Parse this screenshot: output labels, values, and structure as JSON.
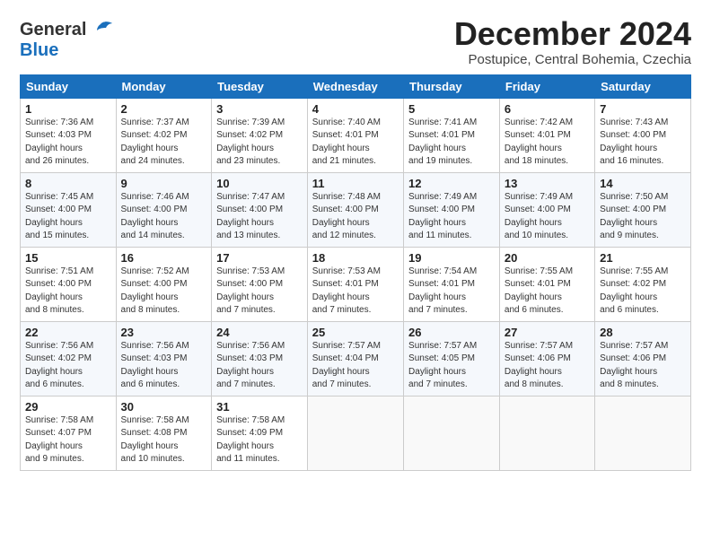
{
  "header": {
    "logo_general": "General",
    "logo_blue": "Blue",
    "month_title": "December 2024",
    "location": "Postupice, Central Bohemia, Czechia"
  },
  "weekdays": [
    "Sunday",
    "Monday",
    "Tuesday",
    "Wednesday",
    "Thursday",
    "Friday",
    "Saturday"
  ],
  "weeks": [
    [
      {
        "day": "1",
        "sunrise": "7:36 AM",
        "sunset": "4:03 PM",
        "daylight": "8 hours and 26 minutes."
      },
      {
        "day": "2",
        "sunrise": "7:37 AM",
        "sunset": "4:02 PM",
        "daylight": "8 hours and 24 minutes."
      },
      {
        "day": "3",
        "sunrise": "7:39 AM",
        "sunset": "4:02 PM",
        "daylight": "8 hours and 23 minutes."
      },
      {
        "day": "4",
        "sunrise": "7:40 AM",
        "sunset": "4:01 PM",
        "daylight": "8 hours and 21 minutes."
      },
      {
        "day": "5",
        "sunrise": "7:41 AM",
        "sunset": "4:01 PM",
        "daylight": "8 hours and 19 minutes."
      },
      {
        "day": "6",
        "sunrise": "7:42 AM",
        "sunset": "4:01 PM",
        "daylight": "8 hours and 18 minutes."
      },
      {
        "day": "7",
        "sunrise": "7:43 AM",
        "sunset": "4:00 PM",
        "daylight": "8 hours and 16 minutes."
      }
    ],
    [
      {
        "day": "8",
        "sunrise": "7:45 AM",
        "sunset": "4:00 PM",
        "daylight": "8 hours and 15 minutes."
      },
      {
        "day": "9",
        "sunrise": "7:46 AM",
        "sunset": "4:00 PM",
        "daylight": "8 hours and 14 minutes."
      },
      {
        "day": "10",
        "sunrise": "7:47 AM",
        "sunset": "4:00 PM",
        "daylight": "8 hours and 13 minutes."
      },
      {
        "day": "11",
        "sunrise": "7:48 AM",
        "sunset": "4:00 PM",
        "daylight": "8 hours and 12 minutes."
      },
      {
        "day": "12",
        "sunrise": "7:49 AM",
        "sunset": "4:00 PM",
        "daylight": "8 hours and 11 minutes."
      },
      {
        "day": "13",
        "sunrise": "7:49 AM",
        "sunset": "4:00 PM",
        "daylight": "8 hours and 10 minutes."
      },
      {
        "day": "14",
        "sunrise": "7:50 AM",
        "sunset": "4:00 PM",
        "daylight": "8 hours and 9 minutes."
      }
    ],
    [
      {
        "day": "15",
        "sunrise": "7:51 AM",
        "sunset": "4:00 PM",
        "daylight": "8 hours and 8 minutes."
      },
      {
        "day": "16",
        "sunrise": "7:52 AM",
        "sunset": "4:00 PM",
        "daylight": "8 hours and 8 minutes."
      },
      {
        "day": "17",
        "sunrise": "7:53 AM",
        "sunset": "4:00 PM",
        "daylight": "8 hours and 7 minutes."
      },
      {
        "day": "18",
        "sunrise": "7:53 AM",
        "sunset": "4:01 PM",
        "daylight": "8 hours and 7 minutes."
      },
      {
        "day": "19",
        "sunrise": "7:54 AM",
        "sunset": "4:01 PM",
        "daylight": "8 hours and 7 minutes."
      },
      {
        "day": "20",
        "sunrise": "7:55 AM",
        "sunset": "4:01 PM",
        "daylight": "8 hours and 6 minutes."
      },
      {
        "day": "21",
        "sunrise": "7:55 AM",
        "sunset": "4:02 PM",
        "daylight": "8 hours and 6 minutes."
      }
    ],
    [
      {
        "day": "22",
        "sunrise": "7:56 AM",
        "sunset": "4:02 PM",
        "daylight": "8 hours and 6 minutes."
      },
      {
        "day": "23",
        "sunrise": "7:56 AM",
        "sunset": "4:03 PM",
        "daylight": "8 hours and 6 minutes."
      },
      {
        "day": "24",
        "sunrise": "7:56 AM",
        "sunset": "4:03 PM",
        "daylight": "8 hours and 7 minutes."
      },
      {
        "day": "25",
        "sunrise": "7:57 AM",
        "sunset": "4:04 PM",
        "daylight": "8 hours and 7 minutes."
      },
      {
        "day": "26",
        "sunrise": "7:57 AM",
        "sunset": "4:05 PM",
        "daylight": "8 hours and 7 minutes."
      },
      {
        "day": "27",
        "sunrise": "7:57 AM",
        "sunset": "4:06 PM",
        "daylight": "8 hours and 8 minutes."
      },
      {
        "day": "28",
        "sunrise": "7:57 AM",
        "sunset": "4:06 PM",
        "daylight": "8 hours and 8 minutes."
      }
    ],
    [
      {
        "day": "29",
        "sunrise": "7:58 AM",
        "sunset": "4:07 PM",
        "daylight": "8 hours and 9 minutes."
      },
      {
        "day": "30",
        "sunrise": "7:58 AM",
        "sunset": "4:08 PM",
        "daylight": "8 hours and 10 minutes."
      },
      {
        "day": "31",
        "sunrise": "7:58 AM",
        "sunset": "4:09 PM",
        "daylight": "8 hours and 11 minutes."
      },
      null,
      null,
      null,
      null
    ]
  ]
}
